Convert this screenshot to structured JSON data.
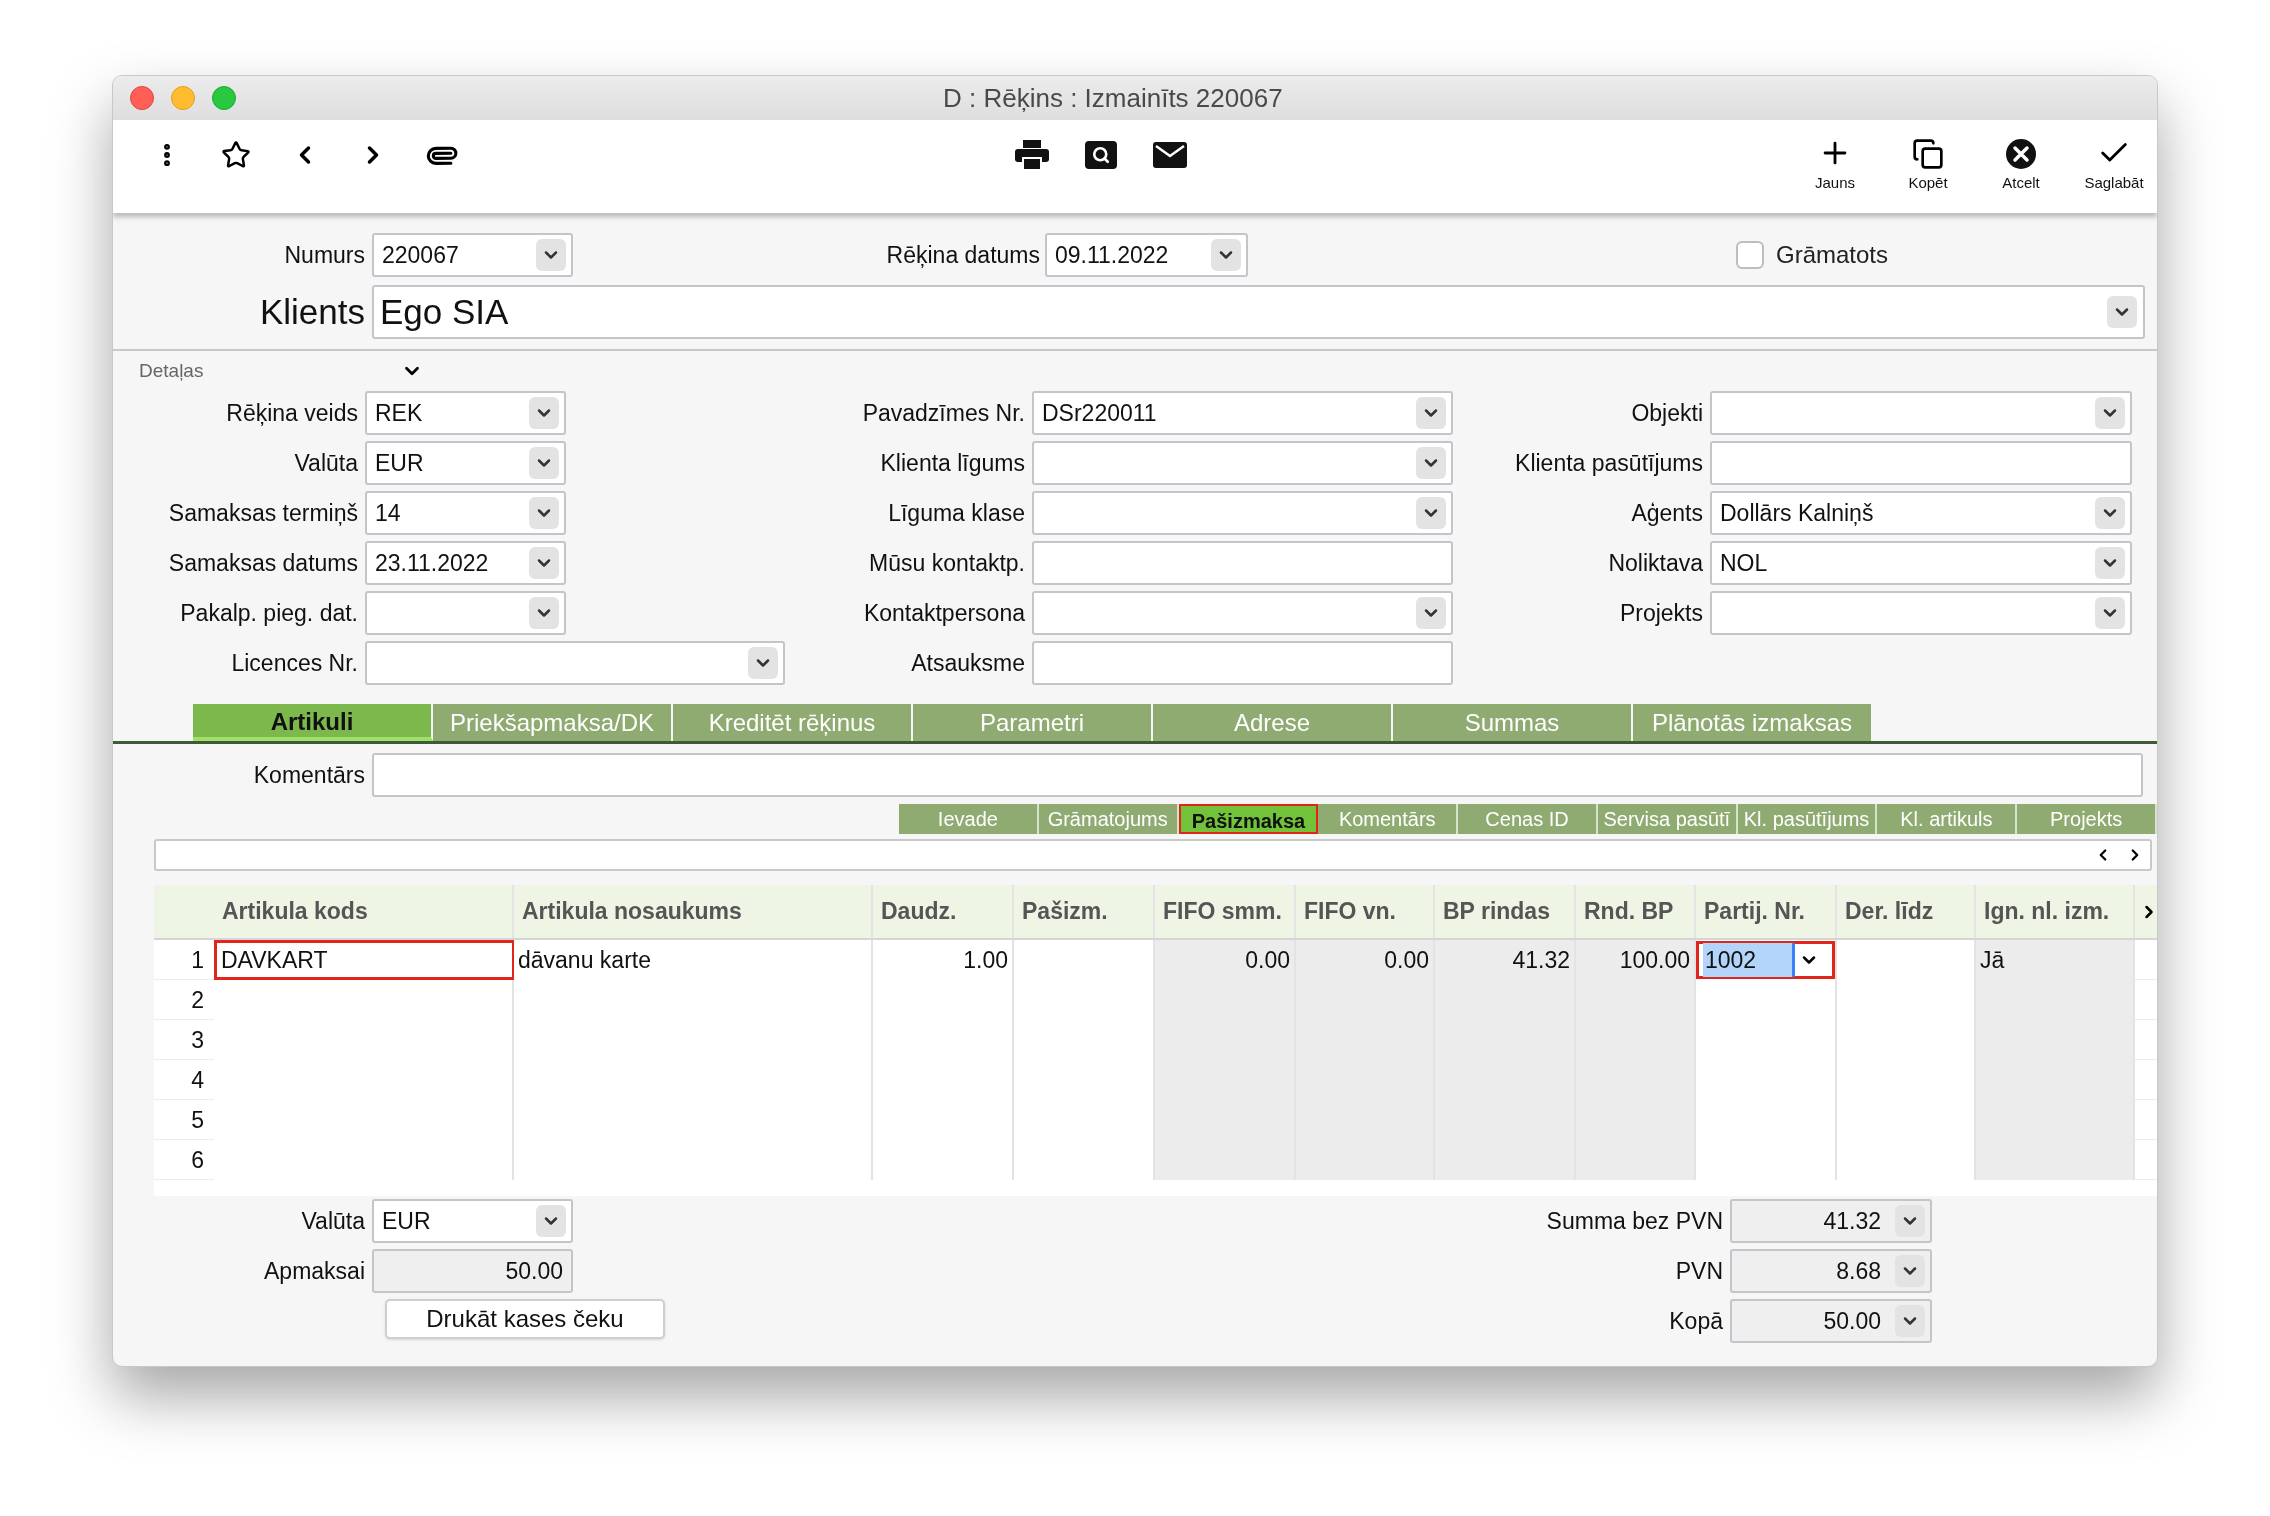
{
  "window": {
    "title": "D : Rēķins : Izmainīts 220067"
  },
  "toolbar": {
    "actions": [
      {
        "kind": "new",
        "label": "Jauns"
      },
      {
        "kind": "copy",
        "label": "Kopēt"
      },
      {
        "kind": "cancel",
        "label": "Atcelt"
      },
      {
        "kind": "save",
        "label": "Saglabāt"
      }
    ]
  },
  "header": {
    "number": {
      "label": "Numurs",
      "value": "220067"
    },
    "invoice_date": {
      "label": "Rēķina datums",
      "value": "09.11.2022"
    },
    "posted": {
      "label": "Grāmatots",
      "checked": false
    },
    "client": {
      "label": "Klients",
      "value": "Ego SIA"
    }
  },
  "details": {
    "label": "Detaļas",
    "expanded": true,
    "columns": [
      [
        {
          "label": "Rēķina veids",
          "value": "REK",
          "kind": "dropdown"
        },
        {
          "label": "Valūta",
          "value": "EUR",
          "kind": "dropdown"
        },
        {
          "label": "Samaksas termiņš",
          "value": "14",
          "kind": "dropdown"
        },
        {
          "label": "Samaksas datums",
          "value": "23.11.2022",
          "kind": "dropdown"
        },
        {
          "label": "Pakalp. pieg. dat.",
          "kind": "dropdown"
        },
        {
          "label": "Licences Nr.",
          "kind": "wide_dropdown"
        }
      ],
      [
        {
          "label": "Pavadzīmes Nr.",
          "value": "DSr220011",
          "kind": "dropdown"
        },
        {
          "label": "Klienta līgums",
          "kind": "dropdown"
        },
        {
          "label": "Līguma klase",
          "kind": "dropdown"
        },
        {
          "label": "Mūsu kontaktp.",
          "kind": "text"
        },
        {
          "label": "Kontaktpersona",
          "kind": "dropdown"
        },
        {
          "label": "Atsauksme",
          "kind": "text"
        }
      ],
      [
        {
          "label": "Objekti",
          "kind": "dropdown"
        },
        {
          "label": "Klienta pasūtījums",
          "kind": "text"
        },
        {
          "label": "Aģents",
          "value": "Dollārs Kalniņš",
          "kind": "dropdown"
        },
        {
          "label": "Noliktava",
          "value": "NOL",
          "kind": "dropdown"
        },
        {
          "label": "Projekts",
          "kind": "dropdown"
        }
      ]
    ]
  },
  "tabs": [
    {
      "label": "Artikuli",
      "selected": true
    },
    {
      "label": "Priekšapmaksa/DK",
      "selected": false
    },
    {
      "label": "Kreditēt rēķinus",
      "selected": false
    },
    {
      "label": "Parametri",
      "selected": false
    },
    {
      "label": "Adrese",
      "selected": false
    },
    {
      "label": "Summas",
      "selected": false
    },
    {
      "label": "Plānotās izmaksas",
      "selected": false
    }
  ],
  "comment": {
    "label": "Komentārs"
  },
  "subtabs": [
    {
      "label": "Ievade",
      "selected": false
    },
    {
      "label": "Grāmatojums",
      "selected": false
    },
    {
      "label": "Pašizmaksa",
      "selected": true
    },
    {
      "label": "Komentārs",
      "selected": false
    },
    {
      "label": "Cenas ID",
      "selected": false
    },
    {
      "label": "Servisa pasūtī",
      "selected": false
    },
    {
      "label": "Kl. pasūtījums",
      "selected": false
    },
    {
      "label": "Kl. artikuls",
      "selected": false
    },
    {
      "label": "Projekts",
      "selected": false
    }
  ],
  "table": {
    "columns": [
      {
        "label": "Artikula kods",
        "kind": "text",
        "shaded": false
      },
      {
        "label": "Artikula nosaukums",
        "kind": "text",
        "shaded": false
      },
      {
        "label": "Daudz.",
        "kind": "number",
        "shaded": false
      },
      {
        "label": "Pašizm.",
        "kind": "number",
        "shaded": false
      },
      {
        "label": "FIFO smm.",
        "kind": "number",
        "shaded": true
      },
      {
        "label": "FIFO vn.",
        "kind": "number",
        "shaded": true
      },
      {
        "label": "BP rindas",
        "kind": "number",
        "shaded": true
      },
      {
        "label": "Rnd. BP",
        "kind": "number",
        "shaded": true
      },
      {
        "label": "Partij. Nr.",
        "kind": "text",
        "shaded": false
      },
      {
        "label": "Der. līdz",
        "kind": "text",
        "shaded": false
      },
      {
        "label": "Ign. nl. izm.",
        "kind": "text",
        "shaded": true
      }
    ],
    "rows": [
      {
        "number": "1",
        "cells": [
          {
            "text": "DAVKART",
            "flagged": true,
            "editing": false
          },
          {
            "text": "dāvanu karte"
          },
          {
            "text": "1.00"
          },
          {},
          {
            "text": "0.00"
          },
          {
            "text": "0.00"
          },
          {
            "text": "41.32"
          },
          {
            "text": "100.00"
          },
          {
            "text": "1002",
            "flagged": true,
            "editing": true
          },
          {},
          {
            "text": "Jā"
          }
        ]
      },
      {
        "number": "2",
        "cells": []
      },
      {
        "number": "3",
        "cells": []
      },
      {
        "number": "4",
        "cells": []
      },
      {
        "number": "5",
        "cells": []
      },
      {
        "number": "6",
        "cells": []
      }
    ]
  },
  "footer": {
    "currency": {
      "label": "Valūta",
      "value": "EUR"
    },
    "to_pay": {
      "label": "Apmaksai",
      "value": "50.00"
    },
    "print_button": "Drukāt kases čeku",
    "totals": [
      {
        "label": "Summa bez PVN",
        "value": "41.32"
      },
      {
        "label": "PVN",
        "value": "8.68"
      },
      {
        "label": "Kopā",
        "value": "50.00"
      }
    ]
  }
}
